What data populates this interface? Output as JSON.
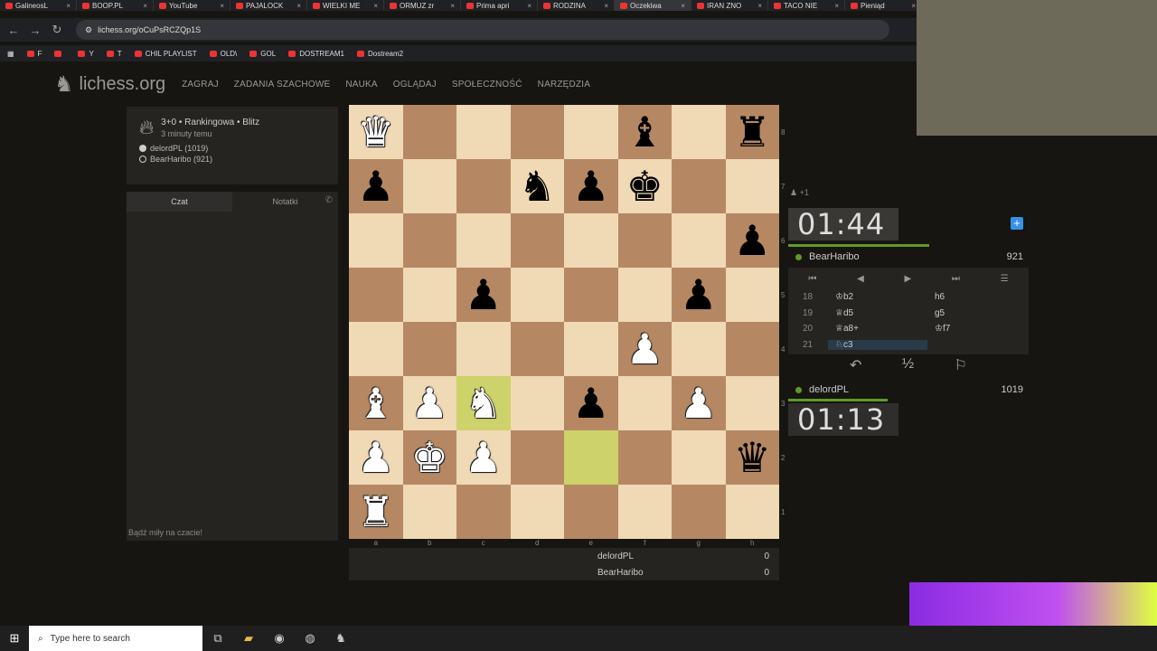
{
  "browser": {
    "tabs": [
      {
        "label": "GalineosL"
      },
      {
        "label": "BOOP.PL"
      },
      {
        "label": "YouTube"
      },
      {
        "label": "PAJALOCK"
      },
      {
        "label": "WIELKI ME"
      },
      {
        "label": "ORMUZ zr"
      },
      {
        "label": "Prima apri"
      },
      {
        "label": "RODZINA"
      },
      {
        "label": "Oczekiwa"
      },
      {
        "label": "IRAN ZNO"
      },
      {
        "label": "TACO NIE"
      },
      {
        "label": "Pieniąd"
      }
    ],
    "url": "lichess.org/oCuPsRCZQp1S",
    "bookmarks": [
      {
        "label": "F"
      },
      {
        "label": ""
      },
      {
        "label": "Y"
      },
      {
        "label": "T"
      },
      {
        "label": "CHIL PLAYLIST"
      },
      {
        "label": "OLD\\"
      },
      {
        "label": "GOL"
      },
      {
        "label": "DOSTREAM1"
      },
      {
        "label": "Dostream2"
      }
    ]
  },
  "site": {
    "logo": "lichess.org",
    "nav": [
      "ZAGRAJ",
      "ZADANIA SZACHOWE",
      "NAUKA",
      "OGLĄDAJ",
      "SPOŁECZNOŚĆ",
      "NARZĘDZIA"
    ]
  },
  "game_info": {
    "title": "3+0 • Rankingowa • Blitz",
    "time_ago": "3 minuty temu",
    "white_player": "delordPL (1019)",
    "black_player": "BearHaribo (921)"
  },
  "chat": {
    "tab_chat": "Czat",
    "tab_notes": "Notatki",
    "placeholder": "Bądź miły na czacie!"
  },
  "board": {
    "files": [
      "a",
      "b",
      "c",
      "d",
      "e",
      "f",
      "g",
      "h"
    ],
    "ranks": [
      "8",
      "7",
      "6",
      "5",
      "4",
      "3",
      "2",
      "1"
    ],
    "squares": [
      [
        "wQ",
        "",
        "",
        "",
        "",
        "bB",
        "",
        "bR"
      ],
      [
        "bP",
        "",
        "",
        "bN",
        "bP",
        "bK",
        "",
        ""
      ],
      [
        "",
        "",
        "",
        "",
        "",
        "",
        "",
        "bP"
      ],
      [
        "",
        "",
        "bP",
        "",
        "",
        "",
        "bP",
        ""
      ],
      [
        "",
        "",
        "",
        "",
        "",
        "wP",
        "",
        ""
      ],
      [
        "wB",
        "wP",
        "wN",
        "",
        "bP",
        "",
        "wP",
        ""
      ],
      [
        "wP",
        "wK",
        "wP",
        "",
        "",
        "",
        "",
        "bQ"
      ],
      [
        "wR",
        "",
        "",
        "",
        "",
        "",
        "",
        ""
      ]
    ],
    "highlights": [
      [
        5,
        2
      ],
      [
        6,
        4
      ]
    ]
  },
  "scores": [
    {
      "name": "delordPL",
      "score": "0"
    },
    {
      "name": "BearHaribo",
      "score": "0"
    }
  ],
  "right_panel": {
    "material": "+1",
    "top_clock": "01:44",
    "top_player": {
      "name": "BearHaribo",
      "rating": "921"
    },
    "moves": [
      {
        "n": "18",
        "w": "♔b2",
        "b": "h6"
      },
      {
        "n": "19",
        "w": "♕d5",
        "b": "g5"
      },
      {
        "n": "20",
        "w": "♕a8+",
        "b": "♔f7"
      },
      {
        "n": "21",
        "w": "♘c3",
        "b": ""
      }
    ],
    "bottom_player": {
      "name": "delordPL",
      "rating": "1019"
    },
    "bottom_clock": "01:13",
    "draw_label": "½"
  },
  "taskbar": {
    "search_placeholder": "Type here to search"
  }
}
